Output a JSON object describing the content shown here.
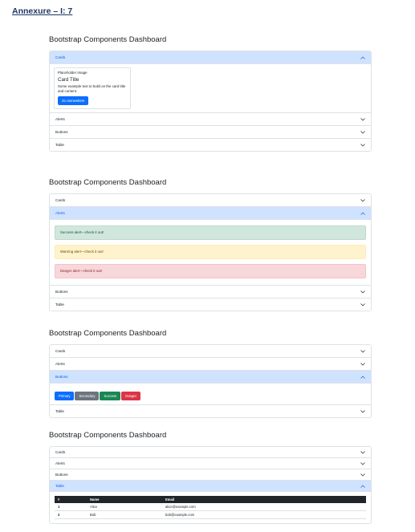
{
  "annexure": "Annexure – I: 7",
  "dashboard_title": "Bootstrap Components Dashboard",
  "sections": [
    "Cards",
    "Alerts",
    "Buttons",
    "Table"
  ],
  "card": {
    "placeholder": "Placeholder Image",
    "title": "Card Title",
    "text": "Some example text to build on the card title and content.",
    "button": "Go somewhere"
  },
  "alerts": {
    "success": "Success alert—check it out!",
    "warning": "Warning alert—check it out!",
    "danger": "Danger alert—check it out!"
  },
  "buttons": {
    "primary": "Primary",
    "secondary": "Secondary",
    "success": "Success",
    "danger": "Danger"
  },
  "table": {
    "headers": [
      "#",
      "Name",
      "Email"
    ],
    "rows": [
      [
        "1",
        "Alice",
        "alice@example.com"
      ],
      [
        "2",
        "Bob",
        "bob@example.com"
      ]
    ]
  },
  "colors": {
    "open_header": "#cfe2ff",
    "primary": "#0d6efd",
    "secondary": "#6c757d",
    "success": "#198754",
    "danger": "#dc3545"
  },
  "icons": {
    "expanded": "chevron-up-icon",
    "collapsed": "chevron-down-icon"
  }
}
